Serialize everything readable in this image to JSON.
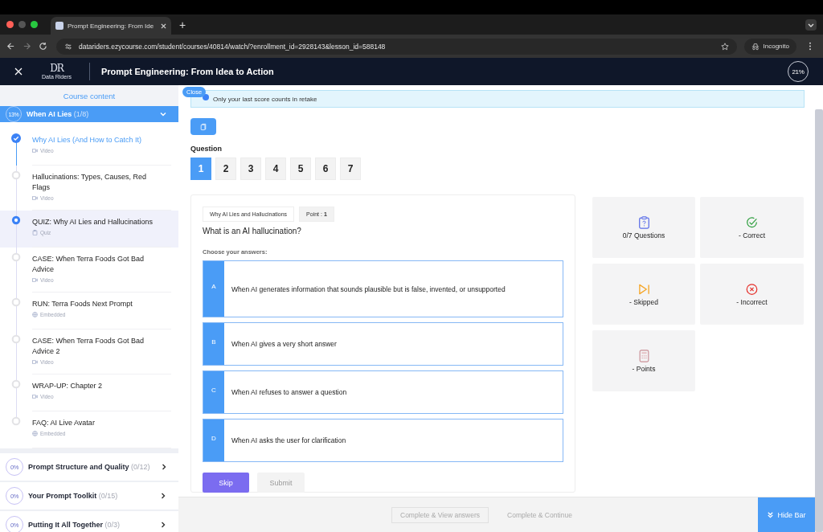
{
  "browser": {
    "tab_title": "Prompt Engineering: From Ide",
    "new_tab": "+",
    "url": "datariders.ezycourse.com/student/courses/40814/watch/?enrollment_id=2928143&lesson_id=588148",
    "profile": "Incognito"
  },
  "header": {
    "logo": "DR",
    "logo_caption": "Data Riders",
    "title": "Prompt Engineering: From Idea to Action",
    "progress": "21%"
  },
  "sidebar": {
    "heading": "Course content",
    "sections": [
      {
        "progress": "13%",
        "title": "When AI Lies",
        "count": "(1/8)",
        "expanded": true,
        "items": [
          {
            "title": "Why AI Lies (And How to Catch It)",
            "kind": "video",
            "type": "Video",
            "completed": true,
            "selected": false
          },
          {
            "title": "Hallucinations: Types, Causes, Red Flags",
            "kind": "video",
            "type": "Video",
            "completed": false,
            "selected": false
          },
          {
            "title": "QUIZ: Why AI Lies and Hallucinations",
            "kind": "quiz",
            "type": "Quiz",
            "completed": false,
            "selected": true
          },
          {
            "title": "CASE: When Terra Foods Got Bad Advice",
            "kind": "video",
            "type": "Video",
            "completed": false,
            "selected": false
          },
          {
            "title": "RUN: Terra Foods Next Prompt",
            "kind": "embedded",
            "type": "Embedded",
            "completed": false,
            "selected": false
          },
          {
            "title": "CASE: When Terra Foods Got Bad Advice 2",
            "kind": "video",
            "type": "Video",
            "completed": false,
            "selected": false
          },
          {
            "title": "WRAP-UP: Chapter 2",
            "kind": "video",
            "type": "Video",
            "completed": false,
            "selected": false
          },
          {
            "title": "FAQ: AI Live Avatar",
            "kind": "embedded",
            "type": "Embedded",
            "completed": false,
            "selected": false
          }
        ]
      },
      {
        "progress": "0%",
        "title": "Prompt Structure and Quality",
        "count": "(0/12)",
        "expanded": false
      },
      {
        "progress": "0%",
        "title": "Your Prompt Toolkit",
        "count": "(0/15)",
        "expanded": false
      },
      {
        "progress": "0%",
        "title": "Putting It All Together",
        "count": "(0/3)",
        "expanded": false
      }
    ]
  },
  "notice": {
    "close": "Close",
    "text": "Only your last score counts in retake"
  },
  "question_label": "Question",
  "question_numbers": [
    {
      "label": "1",
      "selected": true
    },
    {
      "label": "2",
      "selected": false
    },
    {
      "label": "3",
      "selected": false
    },
    {
      "label": "4",
      "selected": false
    },
    {
      "label": "5",
      "selected": false
    },
    {
      "label": "6",
      "selected": false
    },
    {
      "label": "7",
      "selected": false
    }
  ],
  "quiz": {
    "topic": "Why AI Lies and Hallucinations",
    "point": "Point : **1**",
    "question": "What is an AI hallucination?",
    "prompt": "Choose your answers:",
    "options": [
      {
        "letter": "A",
        "text": "When AI generates information that sounds plausible but is false, invented, or unsupported"
      },
      {
        "letter": "B",
        "text": "When AI gives a very short answer"
      },
      {
        "letter": "C",
        "text": "When AI refuses to answer a question"
      },
      {
        "letter": "D",
        "text": "When AI asks the user for clarification"
      }
    ],
    "skip": "Skip",
    "submit": {
      "label": "Submit",
      "disabled": true
    }
  },
  "stats": [
    {
      "kind": "questions",
      "label": "0/7 Questions"
    },
    {
      "kind": "correct",
      "label": "- Correct"
    },
    {
      "kind": "skipped",
      "label": "- Skipped"
    },
    {
      "kind": "incorrect",
      "label": "- Incorrect"
    },
    {
      "kind": "points",
      "label": "- Points"
    }
  ],
  "footer": {
    "buttons": [
      "Complete & View answers",
      "Complete & Continue"
    ],
    "hide_bar": "Hide Bar"
  }
}
